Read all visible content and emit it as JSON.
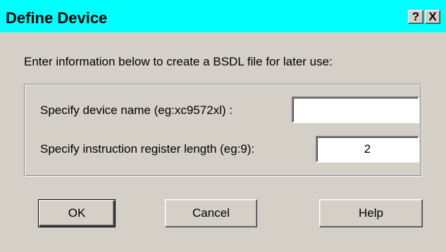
{
  "window": {
    "title": "Define Device",
    "help_button": "?",
    "close_button": "X"
  },
  "instruction": "Enter information below to create a BSDL file for later use:",
  "fields": {
    "device_name": {
      "label": "Specify device name (eg:xc9572xl) :",
      "value": ""
    },
    "register_length": {
      "label": "Specify instruction register length (eg:9):",
      "value": "2"
    }
  },
  "buttons": {
    "ok": "OK",
    "cancel": "Cancel",
    "help": "Help"
  },
  "colors": {
    "titlebar": "#00ffff",
    "dialog_face": "#d4d0c8"
  }
}
